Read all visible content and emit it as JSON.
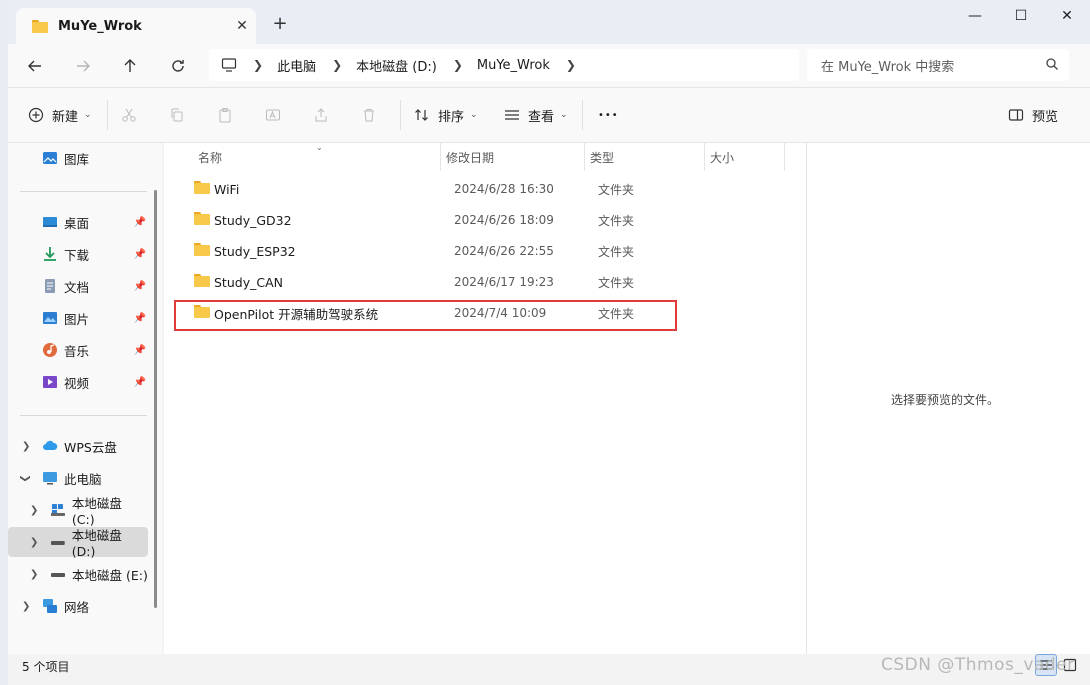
{
  "window": {
    "tab_title": "MuYe_Wrok",
    "new_tab": "+",
    "close_tab": "✕",
    "controls": {
      "minimize": "—",
      "maximize": "☐",
      "close": "✕"
    }
  },
  "address": {
    "breadcrumbs": [
      "此电脑",
      "本地磁盘 (D:)",
      "MuYe_Wrok"
    ],
    "search_placeholder": "在 MuYe_Wrok 中搜索"
  },
  "toolbar": {
    "new_label": "新建",
    "sort_label": "排序",
    "view_label": "查看",
    "more_label": "•••",
    "preview_label": "预览"
  },
  "sidebar": {
    "gallery": "图库",
    "quick_access": [
      {
        "label": "桌面",
        "icon": "desktop-icon"
      },
      {
        "label": "下载",
        "icon": "download-icon"
      },
      {
        "label": "文档",
        "icon": "document-icon"
      },
      {
        "label": "图片",
        "icon": "pictures-icon"
      },
      {
        "label": "音乐",
        "icon": "music-icon"
      },
      {
        "label": "视频",
        "icon": "video-icon"
      }
    ],
    "wps_cloud": "WPS云盘",
    "this_pc": "此电脑",
    "drives": [
      "本地磁盘 (C:)",
      "本地磁盘 (D:)",
      "本地磁盘 (E:)"
    ],
    "network": "网络"
  },
  "columns": {
    "name": "名称",
    "date": "修改日期",
    "type": "类型",
    "size": "大小"
  },
  "files": [
    {
      "name": "WiFi",
      "date": "2024/6/28 16:30",
      "type": "文件夹"
    },
    {
      "name": "Study_GD32",
      "date": "2024/6/26 18:09",
      "type": "文件夹"
    },
    {
      "name": "Study_ESP32",
      "date": "2024/6/26 22:55",
      "type": "文件夹"
    },
    {
      "name": "Study_CAN",
      "date": "2024/6/17 19:23",
      "type": "文件夹"
    },
    {
      "name": "OpenPilot 开源辅助驾驶系统",
      "date": "2024/7/4 10:09",
      "type": "文件夹"
    }
  ],
  "preview": {
    "empty_text": "选择要预览的文件。"
  },
  "status": {
    "item_count": "5 个项目"
  },
  "watermark": "CSDN @Thmos_vader",
  "colors": {
    "highlight": "#e03a3a",
    "folder": "#f8c84a",
    "selected": "#dadada"
  }
}
